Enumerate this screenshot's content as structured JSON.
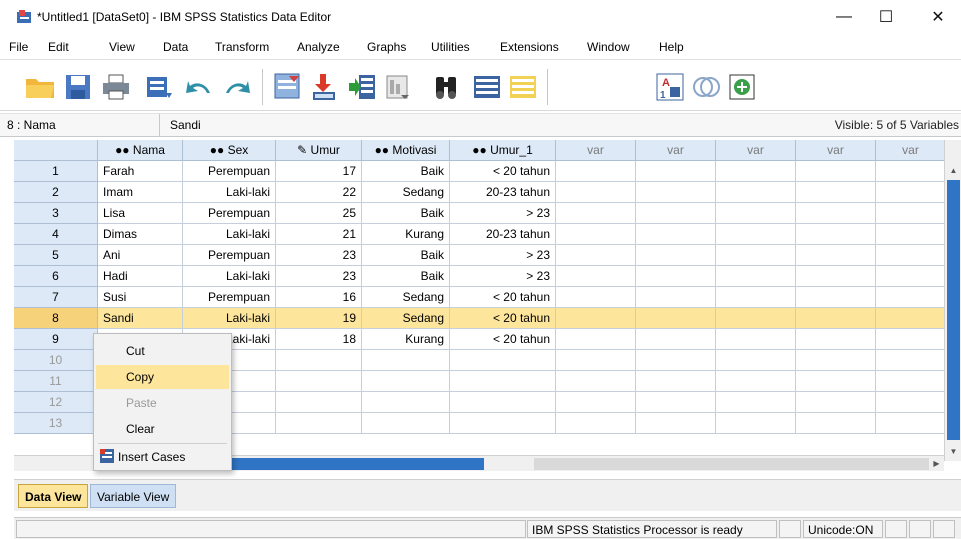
{
  "window": {
    "title": "*Untitled1 [DataSet0] - IBM SPSS Statistics Data Editor",
    "minimize": "—",
    "maximize": "☐",
    "close": "✕"
  },
  "menu": [
    "File",
    "Edit",
    "View",
    "Data",
    "Transform",
    "Analyze",
    "Graphs",
    "Utilities",
    "Extensions",
    "Window",
    "Help"
  ],
  "toolbar": {
    "icons": [
      "open-folder-icon",
      "save-icon",
      "print-icon",
      "dialog-recall-icon",
      "undo-icon",
      "redo-icon",
      "goto-case-icon",
      "goto-variable-icon",
      "variables-icon",
      "run-descriptives-icon",
      "find-icon",
      "insert-cases-icon",
      "insert-variable-icon",
      "split-file-icon",
      "weight-cases-icon",
      "select-cases-icon",
      "value-labels-icon",
      "use-variable-sets-icon",
      "show-all-variables-icon",
      "spelling-icon"
    ]
  },
  "cellbar": {
    "ref": "8 : Nama",
    "value": "Sandi",
    "visible": "Visible: 5 of 5 Variables"
  },
  "grid": {
    "headers": [
      {
        "name": "Nama",
        "icon": "nominal-icon"
      },
      {
        "name": "Sex",
        "icon": "nominal-icon"
      },
      {
        "name": "Umur",
        "icon": "scale-icon"
      },
      {
        "name": "Motivasi",
        "icon": "nominal-icon"
      },
      {
        "name": "Umur_1",
        "icon": "nominal-icon"
      }
    ],
    "var_label": "var",
    "rows": [
      {
        "num": "1",
        "cells": [
          "Farah",
          "Perempuan",
          "17",
          "Baik",
          "< 20 tahun"
        ]
      },
      {
        "num": "2",
        "cells": [
          "Imam",
          "Laki-laki",
          "22",
          "Sedang",
          "20-23 tahun"
        ]
      },
      {
        "num": "3",
        "cells": [
          "Lisa",
          "Perempuan",
          "25",
          "Baik",
          "> 23"
        ]
      },
      {
        "num": "4",
        "cells": [
          "Dimas",
          "Laki-laki",
          "21",
          "Kurang",
          "20-23 tahun"
        ]
      },
      {
        "num": "5",
        "cells": [
          "Ani",
          "Perempuan",
          "23",
          "Baik",
          "> 23"
        ]
      },
      {
        "num": "6",
        "cells": [
          "Hadi",
          "Laki-laki",
          "23",
          "Baik",
          "> 23"
        ]
      },
      {
        "num": "7",
        "cells": [
          "Susi",
          "Perempuan",
          "16",
          "Sedang",
          "< 20 tahun"
        ]
      },
      {
        "num": "8",
        "cells": [
          "Sandi",
          "Laki-laki",
          "19",
          "Sedang",
          "< 20 tahun"
        ]
      },
      {
        "num": "9",
        "cells": [
          "",
          "Laki-laki",
          "18",
          "Kurang",
          "< 20 tahun"
        ]
      },
      {
        "num": "10",
        "cells": [
          "",
          "",
          "",
          "",
          ""
        ]
      },
      {
        "num": "11",
        "cells": [
          "",
          "",
          "",
          "",
          ""
        ]
      },
      {
        "num": "12",
        "cells": [
          "",
          "",
          "",
          "",
          ""
        ]
      },
      {
        "num": "13",
        "cells": [
          "",
          "",
          "",
          "",
          ""
        ]
      }
    ],
    "selected_row": "8"
  },
  "context_menu": {
    "items": [
      {
        "label": "Cut",
        "state": "normal"
      },
      {
        "label": "Copy",
        "state": "highlighted"
      },
      {
        "label": "Paste",
        "state": "disabled"
      },
      {
        "label": "Clear",
        "state": "normal"
      },
      {
        "label": "Insert Cases",
        "state": "normal",
        "icon": "insert-cases-icon"
      }
    ]
  },
  "tabs": {
    "data_view": "Data View",
    "variable_view": "Variable View",
    "active": "Data View"
  },
  "status": {
    "processor": "IBM SPSS Statistics Processor is ready",
    "unicode": "Unicode:ON"
  },
  "colors": {
    "selection": "#fde69c",
    "header": "#dde9f7",
    "scroll_thumb": "#2f74c5"
  }
}
